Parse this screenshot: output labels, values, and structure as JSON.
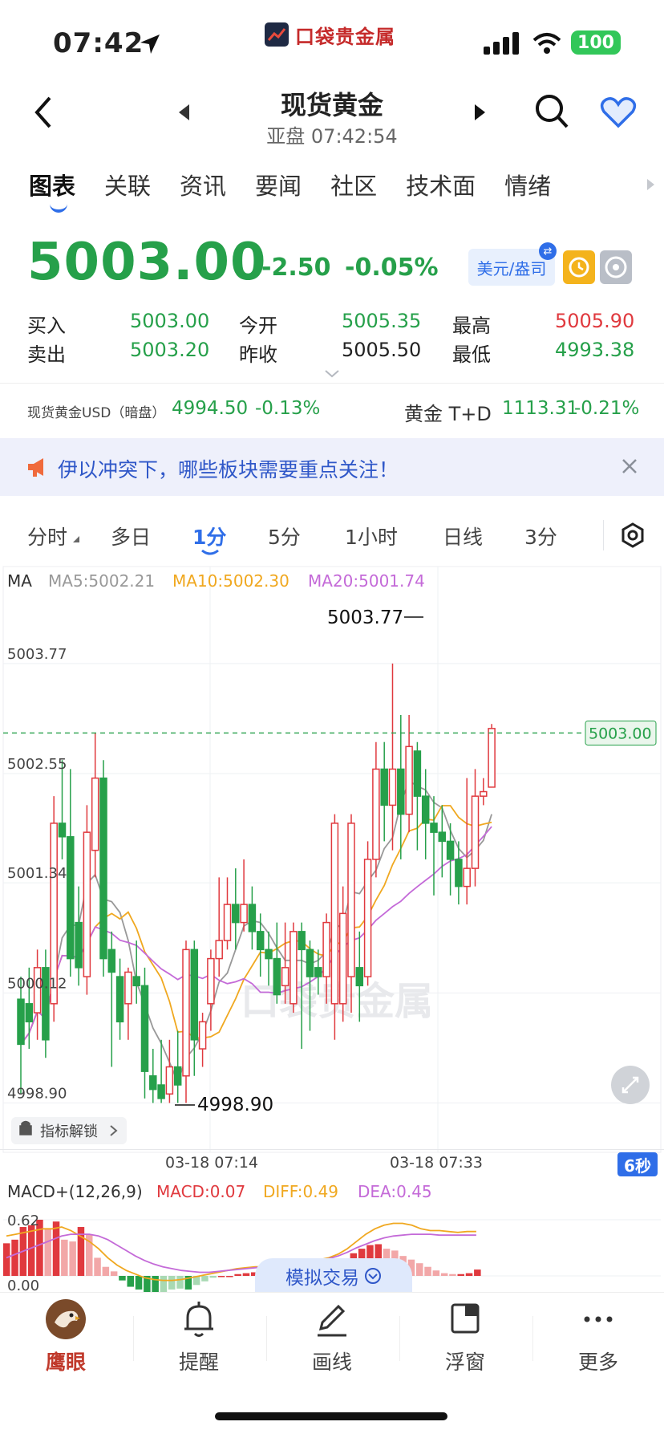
{
  "status_bar": {
    "time": "07:42",
    "app_logo_text": "口袋贵金属",
    "battery": "100"
  },
  "nav": {
    "title": "现货黄金",
    "subtitle": "亚盘 07:42:54"
  },
  "tabs": [
    "图表",
    "关联",
    "资讯",
    "要闻",
    "社区",
    "技术面",
    "情绪"
  ],
  "active_tab": "图表",
  "quote": {
    "price": "5003.00",
    "change": "-2.50",
    "change_pct": "-0.05%",
    "unit": "美元/盎司",
    "rows": [
      {
        "l1": "买入",
        "v1": "5003.00",
        "l2": "今开",
        "v2": "5005.35",
        "l3": "最高",
        "v3": "5005.90"
      },
      {
        "l1": "卖出",
        "v1": "5003.20",
        "l2": "昨收",
        "v2": "5005.50",
        "l3": "最低",
        "v3": "4993.38"
      }
    ]
  },
  "related": {
    "left_name": "现货黄金USD（暗盘）",
    "left_value": "4994.50",
    "left_pct": "-0.13%",
    "right_name": "黄金 T+D",
    "right_value": "1113.31",
    "right_pct": "-0.21%"
  },
  "notice": {
    "text": "伊以冲突下，哪些板块需要重点关注！"
  },
  "periods": [
    "分时",
    "多日",
    "1分",
    "5分",
    "1小时",
    "日线",
    "3分"
  ],
  "active_period": "1分",
  "ma_legend": {
    "ma": "MA",
    "ma5": "MA5:5002.21",
    "ma10": "MA10:5002.30",
    "ma20": "MA20:5001.74"
  },
  "macd_legend": {
    "title": "MACD+(12,26,9)",
    "macd": "MACD:0.07",
    "diff": "DIFF:0.49",
    "dea": "DEA:0.45",
    "top": "0.62",
    "bottom": "0.00"
  },
  "chart_labels": {
    "high_marker": "5003.77",
    "low_marker": "4998.90",
    "last_price": "5003.00",
    "unlock": "指标解锁",
    "time1": "03-18 07:14",
    "time2": "03-18 07:33",
    "refresh": "6秒",
    "sim_trade": "模拟交易",
    "watermark": "口袋贵金属"
  },
  "bottom_nav": [
    "鹰眼",
    "提醒",
    "画线",
    "浮窗",
    "更多"
  ],
  "colors": {
    "up": "#e0393e",
    "down": "#26a04a",
    "accent": "#2f6ee8",
    "ma5": "#999999",
    "ma10": "#f0a820",
    "ma20": "#c46ad8"
  },
  "chart_data": {
    "type": "candlestick",
    "ylim": [
      4998.7,
      5004.0
    ],
    "y_ticks": [
      5003.77,
      5002.55,
      5001.34,
      5000.12,
      4998.9
    ],
    "current_price": 5003.0,
    "candles": [
      {
        "o": 5000.05,
        "c": 4999.55,
        "h": 5000.3,
        "l": 4999.0
      },
      {
        "o": 5000.0,
        "c": 4999.8,
        "h": 5000.4,
        "l": 4999.5
      },
      {
        "o": 4999.9,
        "c": 5000.4,
        "h": 5000.6,
        "l": 4999.6
      },
      {
        "o": 5000.4,
        "c": 4999.6,
        "h": 5000.6,
        "l": 4999.4
      },
      {
        "o": 5000.0,
        "c": 5002.0,
        "h": 5002.3,
        "l": 4999.8
      },
      {
        "o": 5002.0,
        "c": 5001.85,
        "h": 5002.7,
        "l": 5001.6
      },
      {
        "o": 5001.85,
        "c": 5000.5,
        "h": 5002.6,
        "l": 5000.3
      },
      {
        "o": 5000.9,
        "c": 5000.4,
        "h": 5001.3,
        "l": 5000.2
      },
      {
        "o": 5000.3,
        "c": 5001.9,
        "h": 5002.2,
        "l": 5000.1
      },
      {
        "o": 5001.7,
        "c": 5002.5,
        "h": 5003.0,
        "l": 5001.4
      },
      {
        "o": 5002.5,
        "c": 5000.5,
        "h": 5002.7,
        "l": 5000.3
      },
      {
        "o": 5000.6,
        "c": 5000.35,
        "h": 5000.8,
        "l": 4999.3
      },
      {
        "o": 5000.3,
        "c": 4999.8,
        "h": 5000.5,
        "l": 4999.6
      },
      {
        "o": 5000.0,
        "c": 5000.35,
        "h": 5000.4,
        "l": 4999.6
      },
      {
        "o": 5000.3,
        "c": 5000.2,
        "h": 5000.7,
        "l": 5000.0
      },
      {
        "o": 5000.2,
        "c": 4999.25,
        "h": 5000.4,
        "l": 4998.95
      },
      {
        "o": 4999.2,
        "c": 4999.05,
        "h": 4999.5,
        "l": 4998.9
      },
      {
        "o": 4999.1,
        "c": 4998.95,
        "h": 4999.6,
        "l": 4998.9
      },
      {
        "o": 4999.0,
        "c": 4999.3,
        "h": 4999.6,
        "l": 4998.9
      },
      {
        "o": 4999.3,
        "c": 4999.1,
        "h": 4999.7,
        "l": 4998.9
      },
      {
        "o": 4999.2,
        "c": 5000.6,
        "h": 5000.7,
        "l": 4998.9
      },
      {
        "o": 5000.6,
        "c": 4999.6,
        "h": 5000.7,
        "l": 4999.2
      },
      {
        "o": 4999.5,
        "c": 4999.8,
        "h": 4999.9,
        "l": 4999.3
      },
      {
        "o": 5000.0,
        "c": 5000.5,
        "h": 5000.6,
        "l": 4999.7
      },
      {
        "o": 5000.5,
        "c": 5000.7,
        "h": 5001.4,
        "l": 5000.3
      },
      {
        "o": 5000.7,
        "c": 5001.1,
        "h": 5001.4,
        "l": 5000.6
      },
      {
        "o": 5001.1,
        "c": 5000.9,
        "h": 5001.5,
        "l": 5000.6
      },
      {
        "o": 5000.9,
        "c": 5001.1,
        "h": 5001.6,
        "l": 5000.8
      },
      {
        "o": 5001.1,
        "c": 5000.8,
        "h": 5001.3,
        "l": 5000.6
      },
      {
        "o": 5000.8,
        "c": 5000.6,
        "h": 5001.0,
        "l": 5000.3
      },
      {
        "o": 5000.6,
        "c": 5000.5,
        "h": 5000.8,
        "l": 5000.2
      },
      {
        "o": 5000.5,
        "c": 5000.1,
        "h": 5000.9,
        "l": 5000.0
      },
      {
        "o": 5000.2,
        "c": 5000.4,
        "h": 5000.9,
        "l": 5000.0
      },
      {
        "o": 5000.0,
        "c": 5000.8,
        "h": 5000.9,
        "l": 4999.9
      },
      {
        "o": 5000.8,
        "c": 5000.6,
        "h": 5000.9,
        "l": 4999.5
      },
      {
        "o": 5000.6,
        "c": 5000.3,
        "h": 5000.7,
        "l": 4999.7
      },
      {
        "o": 5000.4,
        "c": 5000.3,
        "h": 5000.6,
        "l": 5000.1
      },
      {
        "o": 5000.3,
        "c": 5000.9,
        "h": 5001.0,
        "l": 5000.0
      },
      {
        "o": 5000.0,
        "c": 5002.0,
        "h": 5002.1,
        "l": 4999.6
      },
      {
        "o": 5000.0,
        "c": 5001.0,
        "h": 5001.3,
        "l": 4999.8
      },
      {
        "o": 5000.3,
        "c": 5002.0,
        "h": 5002.1,
        "l": 4999.9
      },
      {
        "o": 5000.4,
        "c": 5000.2,
        "h": 5000.8,
        "l": 4999.8
      },
      {
        "o": 5000.3,
        "c": 5001.6,
        "h": 5001.8,
        "l": 5000.2
      },
      {
        "o": 5001.6,
        "c": 5002.6,
        "h": 5002.9,
        "l": 5001.4
      },
      {
        "o": 5002.6,
        "c": 5002.2,
        "h": 5002.9,
        "l": 5001.8
      },
      {
        "o": 5002.2,
        "c": 5002.6,
        "h": 5003.77,
        "l": 5001.7
      },
      {
        "o": 5002.6,
        "c": 5002.1,
        "h": 5003.2,
        "l": 5001.6
      },
      {
        "o": 5002.1,
        "c": 5002.85,
        "h": 5003.2,
        "l": 5001.9
      },
      {
        "o": 5002.8,
        "c": 5002.3,
        "h": 5002.9,
        "l": 5001.7
      },
      {
        "o": 5002.3,
        "c": 5002.0,
        "h": 5002.6,
        "l": 5001.6
      },
      {
        "o": 5002.0,
        "c": 5001.9,
        "h": 5002.3,
        "l": 5001.2
      },
      {
        "o": 5001.9,
        "c": 5001.8,
        "h": 5002.2,
        "l": 5001.4
      },
      {
        "o": 5001.8,
        "c": 5001.6,
        "h": 5002.0,
        "l": 5001.2
      },
      {
        "o": 5001.6,
        "c": 5001.3,
        "h": 5001.8,
        "l": 5001.1
      },
      {
        "o": 5001.3,
        "c": 5001.5,
        "h": 5002.5,
        "l": 5001.1
      },
      {
        "o": 5001.5,
        "c": 5002.3,
        "h": 5002.6,
        "l": 5001.3
      },
      {
        "o": 5002.3,
        "c": 5002.35,
        "h": 5002.5,
        "l": 5002.2
      },
      {
        "o": 5002.4,
        "c": 5003.05,
        "h": 5003.1,
        "l": 5002.4
      }
    ],
    "macd_histogram": [
      0.36,
      0.4,
      0.54,
      0.56,
      0.62,
      0.52,
      0.6,
      0.4,
      0.38,
      0.54,
      0.46,
      0.2,
      0.1,
      0.05,
      -0.05,
      -0.12,
      -0.15,
      -0.2,
      -0.2,
      -0.18,
      -0.15,
      -0.14,
      -0.15,
      -0.1,
      -0.06,
      -0.02,
      0.0,
      0.0,
      0.02,
      0.03,
      0.04,
      0.05,
      0.06,
      0.04,
      0.04,
      0.04,
      0.05,
      0.06,
      0.07,
      0.1,
      0.14,
      0.18,
      0.25,
      0.3,
      0.34,
      0.35,
      0.3,
      0.28,
      0.22,
      0.18,
      0.14,
      0.1,
      0.06,
      0.03,
      0.02,
      0.02,
      0.03,
      0.07
    ],
    "diff_line": [
      0.44,
      0.46,
      0.48,
      0.5,
      0.52,
      0.52,
      0.54,
      0.5,
      0.44,
      0.38,
      0.3,
      0.2,
      0.12,
      0.06,
      0.02,
      -0.02,
      -0.04,
      -0.05,
      -0.05,
      -0.04,
      -0.02,
      0.0,
      0.02,
      0.04,
      0.06,
      0.08,
      0.09,
      0.1,
      0.1,
      0.1,
      0.11,
      0.12,
      0.14,
      0.16,
      0.18,
      0.2,
      0.24,
      0.3,
      0.38,
      0.46,
      0.52,
      0.56,
      0.58,
      0.58,
      0.56,
      0.52,
      0.5,
      0.5,
      0.49,
      0.48,
      0.49,
      0.49
    ],
    "dea_line": [
      0.2,
      0.24,
      0.28,
      0.32,
      0.36,
      0.4,
      0.44,
      0.46,
      0.46,
      0.46,
      0.44,
      0.4,
      0.34,
      0.28,
      0.22,
      0.17,
      0.13,
      0.1,
      0.08,
      0.06,
      0.05,
      0.04,
      0.04,
      0.05,
      0.06,
      0.07,
      0.08,
      0.09,
      0.1,
      0.11,
      0.12,
      0.13,
      0.14,
      0.15,
      0.17,
      0.19,
      0.22,
      0.26,
      0.31,
      0.35,
      0.39,
      0.42,
      0.44,
      0.45,
      0.46,
      0.46,
      0.46,
      0.45,
      0.45,
      0.45,
      0.45,
      0.45
    ]
  }
}
